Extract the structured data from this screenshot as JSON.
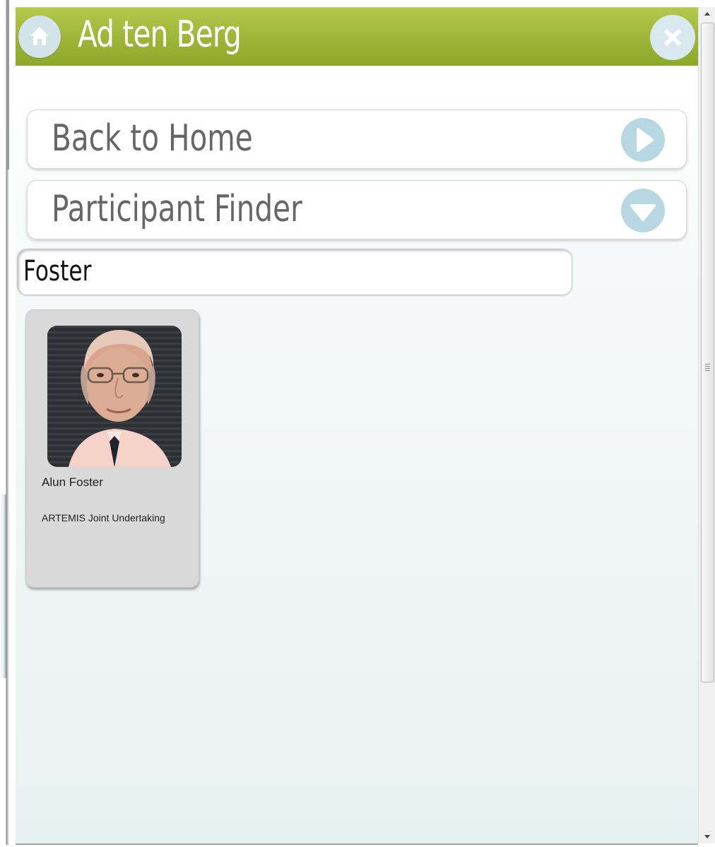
{
  "header": {
    "title": "Ad ten Berg",
    "home_icon": "home-icon",
    "close_icon": "close-icon",
    "color": "#a1b83a"
  },
  "menu": {
    "back_label": "Back to Home",
    "back_icon": "arrow-right-icon",
    "finder_label": "Participant Finder",
    "finder_icon": "arrow-down-icon",
    "icon_color": "#b7d8e2"
  },
  "search": {
    "value": "Foster"
  },
  "results": [
    {
      "name": "Alun Foster",
      "organisation": "ARTEMIS Joint Undertaking",
      "photo": "portrait-photo"
    }
  ]
}
